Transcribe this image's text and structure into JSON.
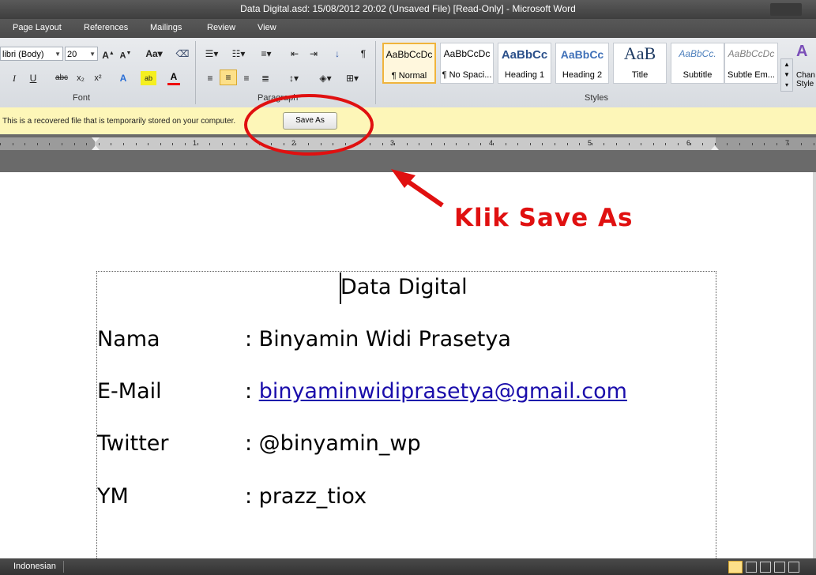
{
  "window": {
    "title": "Data Digital.asd: 15/08/2012 20:02 (Unsaved File) [Read-Only]  -  Microsoft Word"
  },
  "tabs": [
    "Page Layout",
    "References",
    "Mailings",
    "Review",
    "View"
  ],
  "ribbon": {
    "font_group": {
      "label": "Font",
      "font_name": "libri (Body)",
      "font_size": "20"
    },
    "paragraph_group": {
      "label": "Paragraph"
    },
    "styles_group": {
      "label": "Styles",
      "styles": [
        {
          "sample": "AaBbCcDc",
          "name": "¶ Normal"
        },
        {
          "sample": "AaBbCcDc",
          "name": "¶ No Spaci..."
        },
        {
          "sample": "AaBbCc",
          "name": "Heading 1"
        },
        {
          "sample": "AaBbCc",
          "name": "Heading 2"
        },
        {
          "sample": "AaB",
          "name": "Title"
        },
        {
          "sample": "AaBbCc.",
          "name": "Subtitle"
        },
        {
          "sample": "AaBbCcDc",
          "name": "Subtle Em..."
        }
      ],
      "change_styles_line1": "Chan",
      "change_styles_line2": "Style"
    }
  },
  "message_bar": {
    "text": "This is a recovered file that is temporarily stored on your computer.",
    "button": "Save As"
  },
  "ruler": {
    "numbers": [
      "1",
      "2",
      "3",
      "4",
      "5",
      "6",
      "7"
    ]
  },
  "annotation": {
    "text": "Klik Save As"
  },
  "document": {
    "title": "Data Digital",
    "rows": [
      {
        "label": "Nama",
        "value": ": Binyamin Widi Prasetya"
      },
      {
        "label": "E-Mail",
        "sep": ": ",
        "value": "binyaminwidiprasetya@gmail.com"
      },
      {
        "label": "Twitter",
        "value": ": @binyamin_wp"
      },
      {
        "label": "YM",
        "value": ": prazz_tiox"
      }
    ]
  },
  "status_bar": {
    "language": "Indonesian"
  },
  "colors": {
    "accent_red": "#e01010",
    "message_bar": "#fdf6b8",
    "link": "#1a0dab"
  }
}
